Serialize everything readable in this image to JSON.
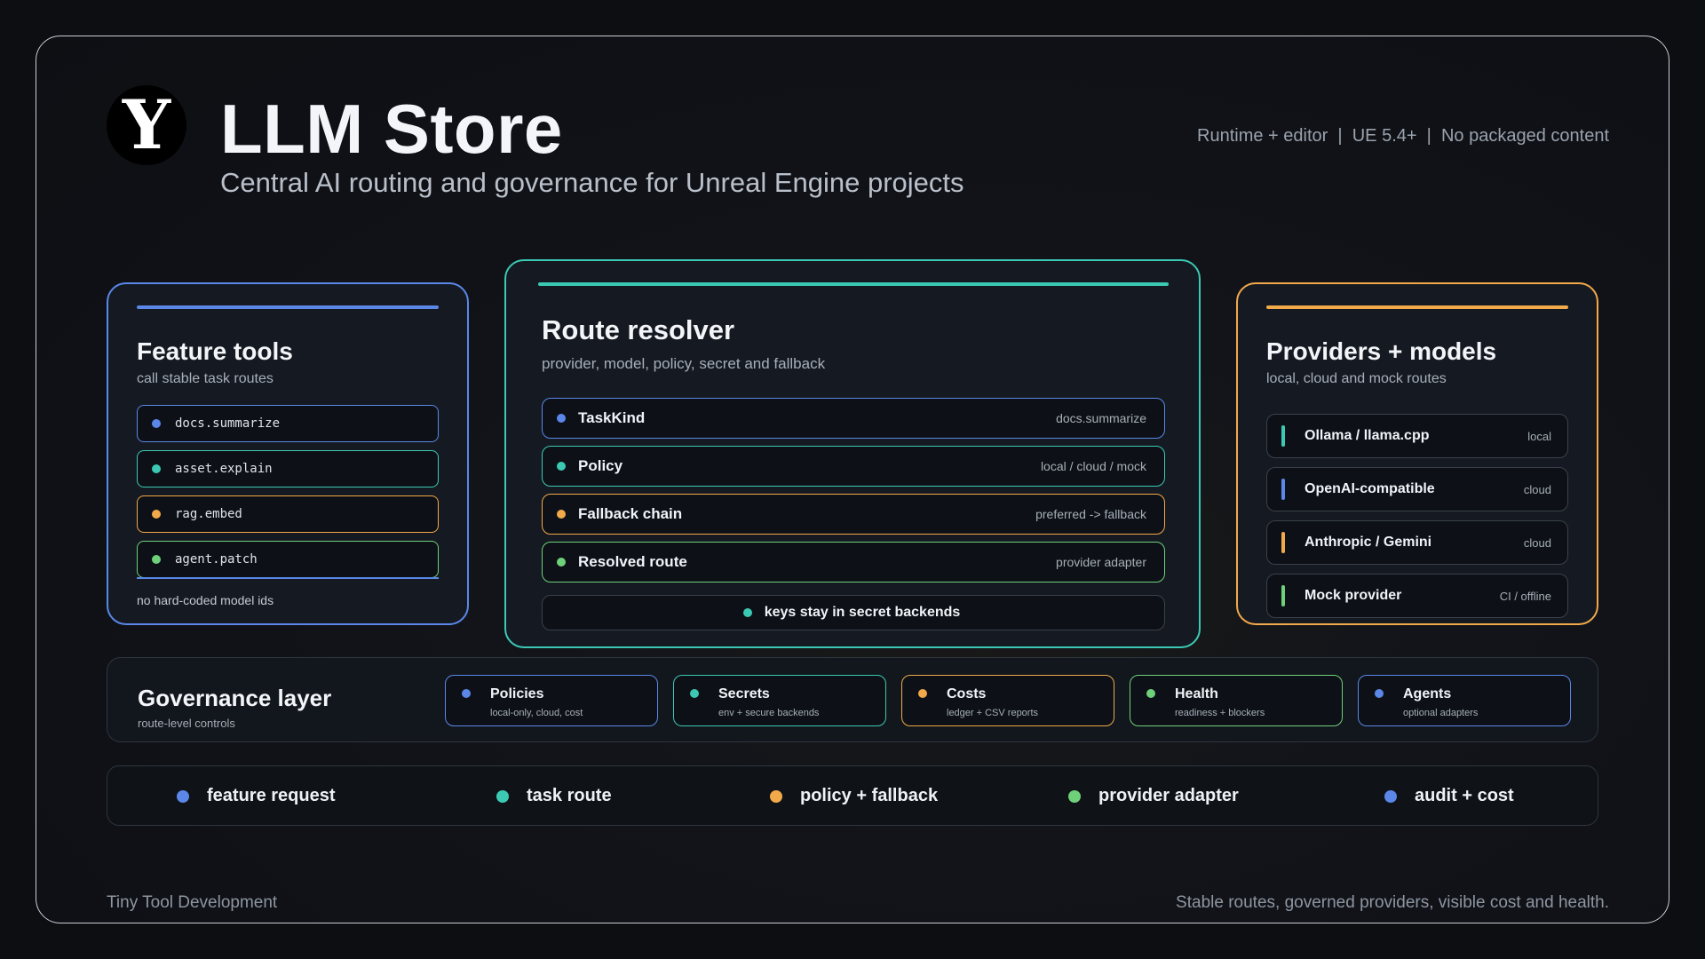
{
  "header": {
    "logo_letter": "Y",
    "title": "LLM Store",
    "subtitle": "Central AI routing and governance for Unreal Engine projects",
    "meta": "Runtime + editor  |  UE 5.4+  |  No packaged content"
  },
  "colors": {
    "blue": "#5b87e8",
    "teal": "#3cc9b4",
    "orange": "#f2a94a",
    "green": "#6fd07a"
  },
  "feature_tools": {
    "title": "Feature tools",
    "subtitle": "call stable task routes",
    "items": [
      {
        "label": "docs.summarize",
        "color": "blue"
      },
      {
        "label": "asset.explain",
        "color": "teal"
      },
      {
        "label": "rag.embed",
        "color": "orange"
      },
      {
        "label": "agent.patch",
        "color": "green"
      }
    ],
    "note": "no hard-coded model ids"
  },
  "route_resolver": {
    "title": "Route resolver",
    "subtitle": "provider, model, policy, secret and fallback",
    "rows": [
      {
        "label": "TaskKind",
        "value": "docs.summarize",
        "color": "blue"
      },
      {
        "label": "Policy",
        "value": "local / cloud / mock",
        "color": "teal"
      },
      {
        "label": "Fallback chain",
        "value": "preferred -> fallback",
        "color": "orange"
      },
      {
        "label": "Resolved route",
        "value": "provider adapter",
        "color": "green"
      }
    ],
    "footer": "keys stay in secret backends"
  },
  "providers": {
    "title": "Providers + models",
    "subtitle": "local, cloud and mock routes",
    "items": [
      {
        "label": "Ollama / llama.cpp",
        "value": "local",
        "color": "teal"
      },
      {
        "label": "OpenAI-compatible",
        "value": "cloud",
        "color": "blue"
      },
      {
        "label": "Anthropic / Gemini",
        "value": "cloud",
        "color": "orange"
      },
      {
        "label": "Mock provider",
        "value": "CI / offline",
        "color": "green"
      }
    ]
  },
  "governance": {
    "title": "Governance layer",
    "subtitle": "route-level controls",
    "items": [
      {
        "label": "Policies",
        "value": "local-only, cloud, cost",
        "color": "blue"
      },
      {
        "label": "Secrets",
        "value": "env + secure backends",
        "color": "teal"
      },
      {
        "label": "Costs",
        "value": "ledger + CSV reports",
        "color": "orange"
      },
      {
        "label": "Health",
        "value": "readiness + blockers",
        "color": "green"
      },
      {
        "label": "Agents",
        "value": "optional adapters",
        "color": "blue"
      }
    ]
  },
  "flow": [
    {
      "label": "feature request",
      "color": "blue"
    },
    {
      "label": "task route",
      "color": "teal"
    },
    {
      "label": "policy + fallback",
      "color": "orange"
    },
    {
      "label": "provider adapter",
      "color": "green"
    },
    {
      "label": "audit + cost",
      "color": "blue"
    }
  ],
  "footer": {
    "left": "Tiny Tool Development",
    "right": "Stable routes, governed providers, visible cost and health."
  }
}
